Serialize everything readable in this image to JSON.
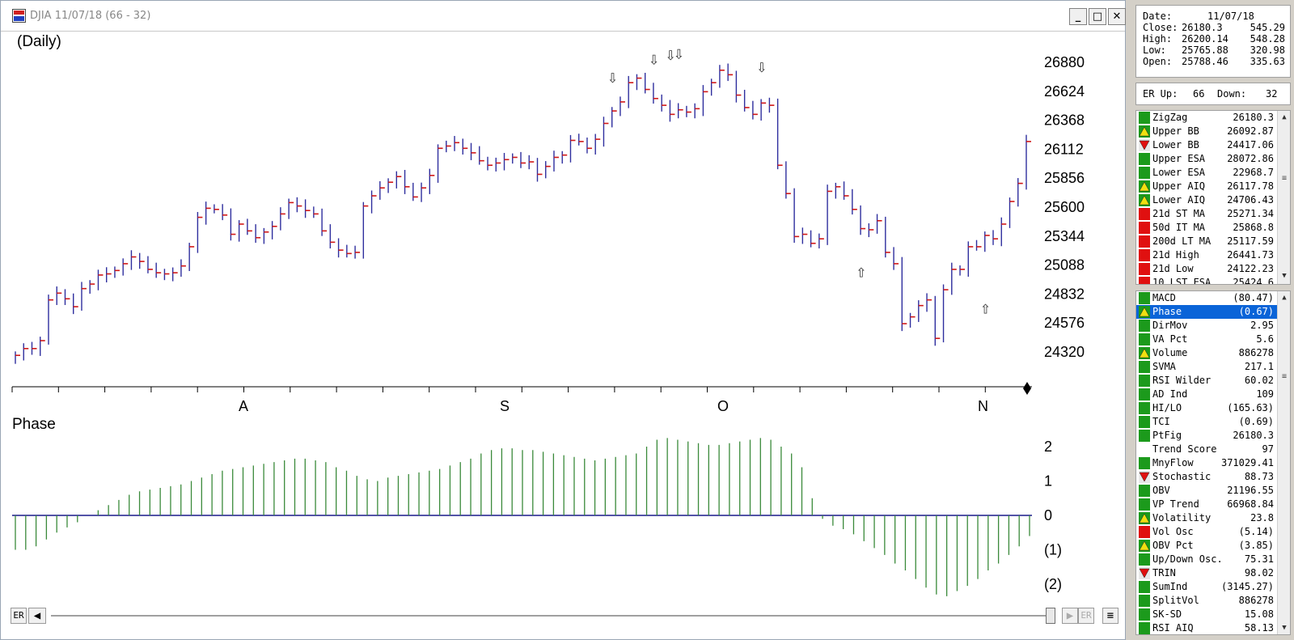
{
  "window": {
    "title": "DJIA 11/07/18 (66 - 32)"
  },
  "chart": {
    "period_label": "(Daily)",
    "price_ticks": [
      "26880",
      "26624",
      "26368",
      "26112",
      "25856",
      "25600",
      "25344",
      "25088",
      "24832",
      "24576",
      "24320"
    ],
    "month_labels": [
      "A",
      "S",
      "O",
      "N"
    ],
    "indicator_label": "Phase",
    "indicator_ticks": [
      "2",
      "1",
      "0",
      "(1)",
      "(2)"
    ],
    "colors": {
      "up_bar": "#2e2e9e",
      "tick": "#d01818",
      "hist": "#3a8a3a",
      "zero_line": "#1a1a8c"
    }
  },
  "chart_data": {
    "type": "bar",
    "title": "(Daily)",
    "price_ylim": [
      24200,
      26980
    ],
    "ohlc_close": [
      24290,
      24350,
      24350,
      24420,
      24780,
      24840,
      24790,
      24720,
      24880,
      24920,
      25000,
      25010,
      25040,
      25100,
      25160,
      25120,
      25050,
      25020,
      25010,
      25020,
      25080,
      25250,
      25510,
      25590,
      25580,
      25530,
      25360,
      25450,
      25390,
      25330,
      25380,
      25430,
      25540,
      25640,
      25610,
      25570,
      25540,
      25390,
      25290,
      25220,
      25190,
      25200,
      25610,
      25700,
      25770,
      25820,
      25870,
      25780,
      25690,
      25770,
      25880,
      26120,
      26140,
      26170,
      26120,
      26080,
      26010,
      25970,
      25990,
      26020,
      26040,
      25990,
      26000,
      25890,
      25960,
      26040,
      26060,
      26190,
      26180,
      26120,
      26200,
      26340,
      26450,
      26530,
      26700,
      26740,
      26640,
      26560,
      26500,
      26420,
      26460,
      26440,
      26470,
      26620,
      26700,
      26810,
      26770,
      26590,
      26480,
      26420,
      26520,
      26500,
      25970,
      25720,
      25340,
      25360,
      25280,
      25320,
      25740,
      25780,
      25700,
      25580,
      25410,
      25400,
      25480,
      25200,
      25100,
      24570,
      24630,
      24730,
      24780,
      24440,
      24870,
      25050,
      25050,
      25250,
      25250,
      25350,
      25320,
      25450,
      25650,
      25810,
      26180
    ],
    "price_ticks": [
      26880,
      26624,
      26368,
      26112,
      25856,
      25600,
      25344,
      25088,
      24832,
      24576,
      24320
    ],
    "months": [
      "A",
      "S",
      "O",
      "N"
    ],
    "phase": {
      "name": "Phase",
      "ylim": [
        -2.5,
        2.5
      ],
      "ticks": [
        "2",
        "1",
        "0",
        "(1)",
        "(2)"
      ],
      "values": [
        -1.0,
        -1.0,
        -0.9,
        -0.7,
        -0.5,
        -0.35,
        -0.2,
        0.0,
        0.15,
        0.3,
        0.45,
        0.6,
        0.7,
        0.75,
        0.8,
        0.85,
        0.9,
        1.0,
        1.1,
        1.2,
        1.3,
        1.35,
        1.4,
        1.45,
        1.5,
        1.55,
        1.6,
        1.65,
        1.65,
        1.6,
        1.55,
        1.4,
        1.3,
        1.15,
        1.05,
        1.0,
        1.1,
        1.15,
        1.2,
        1.25,
        1.3,
        1.35,
        1.45,
        1.55,
        1.65,
        1.8,
        1.9,
        1.95,
        1.95,
        1.9,
        1.9,
        1.85,
        1.8,
        1.75,
        1.7,
        1.65,
        1.6,
        1.65,
        1.7,
        1.75,
        1.8,
        2.0,
        2.2,
        2.25,
        2.2,
        2.15,
        2.1,
        2.05,
        2.05,
        2.1,
        2.15,
        2.2,
        2.25,
        2.2,
        2.0,
        1.8,
        1.4,
        0.5,
        -0.1,
        -0.3,
        -0.4,
        -0.55,
        -0.75,
        -0.95,
        -1.15,
        -1.4,
        -1.6,
        -1.85,
        -2.1,
        -2.3,
        -2.35,
        -2.2,
        -2.05,
        -1.85,
        -1.6,
        -1.4,
        -1.15,
        -0.9,
        -0.6
      ]
    },
    "signal_arrows": [
      {
        "type": "down",
        "price": 26560
      },
      {
        "type": "down",
        "price": 26720
      },
      {
        "type": "down",
        "price": 26760
      },
      {
        "type": "down",
        "price": 26770
      },
      {
        "type": "down",
        "price": 26650
      },
      {
        "type": "up",
        "price": 25180
      },
      {
        "type": "up",
        "price": 24860
      }
    ]
  },
  "scroll": {
    "left_label": "ER",
    "right_label": "ER"
  },
  "side_panel": {
    "info": [
      {
        "label": "Date:",
        "v1": "11/07/18",
        "v2": ""
      },
      {
        "label": "Close:",
        "v1": "26180.3",
        "v2": "545.29"
      },
      {
        "label": "High:",
        "v1": "26200.14",
        "v2": "548.28"
      },
      {
        "label": "Low:",
        "v1": "25765.88",
        "v2": "320.98"
      },
      {
        "label": "Open:",
        "v1": "25788.46",
        "v2": "335.63"
      }
    ],
    "er": {
      "up_label": "ER Up:",
      "up": "66",
      "down_label": "Down:",
      "down": "32"
    },
    "list1": [
      {
        "name": "ZigZag",
        "value": "26180.3",
        "status": "green"
      },
      {
        "name": "Upper BB",
        "value": "26092.87",
        "status": "up"
      },
      {
        "name": "Lower BB",
        "value": "24417.06",
        "status": "down"
      },
      {
        "name": "Upper ESA",
        "value": "28072.86",
        "status": "green"
      },
      {
        "name": "Lower ESA",
        "value": "22968.7",
        "status": "green"
      },
      {
        "name": "Upper AIQ",
        "value": "26117.78",
        "status": "up"
      },
      {
        "name": "Lower AIQ",
        "value": "24706.43",
        "status": "up"
      },
      {
        "name": "21d ST MA",
        "value": "25271.34",
        "status": "red"
      },
      {
        "name": "50d IT MA",
        "value": "25868.8",
        "status": "red"
      },
      {
        "name": "200d LT MA",
        "value": "25117.59",
        "status": "red"
      },
      {
        "name": "21d High",
        "value": "26441.73",
        "status": "red"
      },
      {
        "name": "21d Low",
        "value": "24122.23",
        "status": "red"
      },
      {
        "name": "10 LST ESA",
        "value": "25424.6",
        "status": "red"
      }
    ],
    "list2": [
      {
        "name": "MACD",
        "value": "(80.47)",
        "status": "green"
      },
      {
        "name": "Phase",
        "value": "(0.67)",
        "status": "up",
        "selected": true
      },
      {
        "name": "DirMov",
        "value": "2.95",
        "status": "green"
      },
      {
        "name": "VA Pct",
        "value": "5.6",
        "status": "green"
      },
      {
        "name": "Volume",
        "value": "886278",
        "status": "up"
      },
      {
        "name": "SVMA",
        "value": "217.1",
        "status": "green"
      },
      {
        "name": "RSI Wilder",
        "value": "60.02",
        "status": "green"
      },
      {
        "name": "AD Ind",
        "value": "109",
        "status": "green"
      },
      {
        "name": "HI/LO",
        "value": "(165.63)",
        "status": "green"
      },
      {
        "name": "TCI",
        "value": "(0.69)",
        "status": "green"
      },
      {
        "name": "PtFig",
        "value": "26180.3",
        "status": "green"
      },
      {
        "name": "Trend Score",
        "value": "97",
        "status": "none"
      },
      {
        "name": "MnyFlow",
        "value": "371029.41",
        "status": "green"
      },
      {
        "name": "Stochastic",
        "value": "88.73",
        "status": "down"
      },
      {
        "name": "OBV",
        "value": "21196.55",
        "status": "green"
      },
      {
        "name": "VP Trend",
        "value": "66968.84",
        "status": "green"
      },
      {
        "name": "Volatility",
        "value": "23.8",
        "status": "up"
      },
      {
        "name": "Vol Osc",
        "value": "(5.14)",
        "status": "red"
      },
      {
        "name": "OBV Pct",
        "value": "(3.85)",
        "status": "up"
      },
      {
        "name": "Up/Down Osc.",
        "value": "75.31",
        "status": "green"
      },
      {
        "name": "TRIN",
        "value": "98.02",
        "status": "down"
      },
      {
        "name": "SumInd",
        "value": "(3145.27)",
        "status": "green"
      },
      {
        "name": "SplitVol",
        "value": "886278",
        "status": "green"
      },
      {
        "name": "SK-SD",
        "value": "15.08",
        "status": "green"
      },
      {
        "name": "RSI AIQ",
        "value": "58.13",
        "status": "green"
      }
    ]
  }
}
